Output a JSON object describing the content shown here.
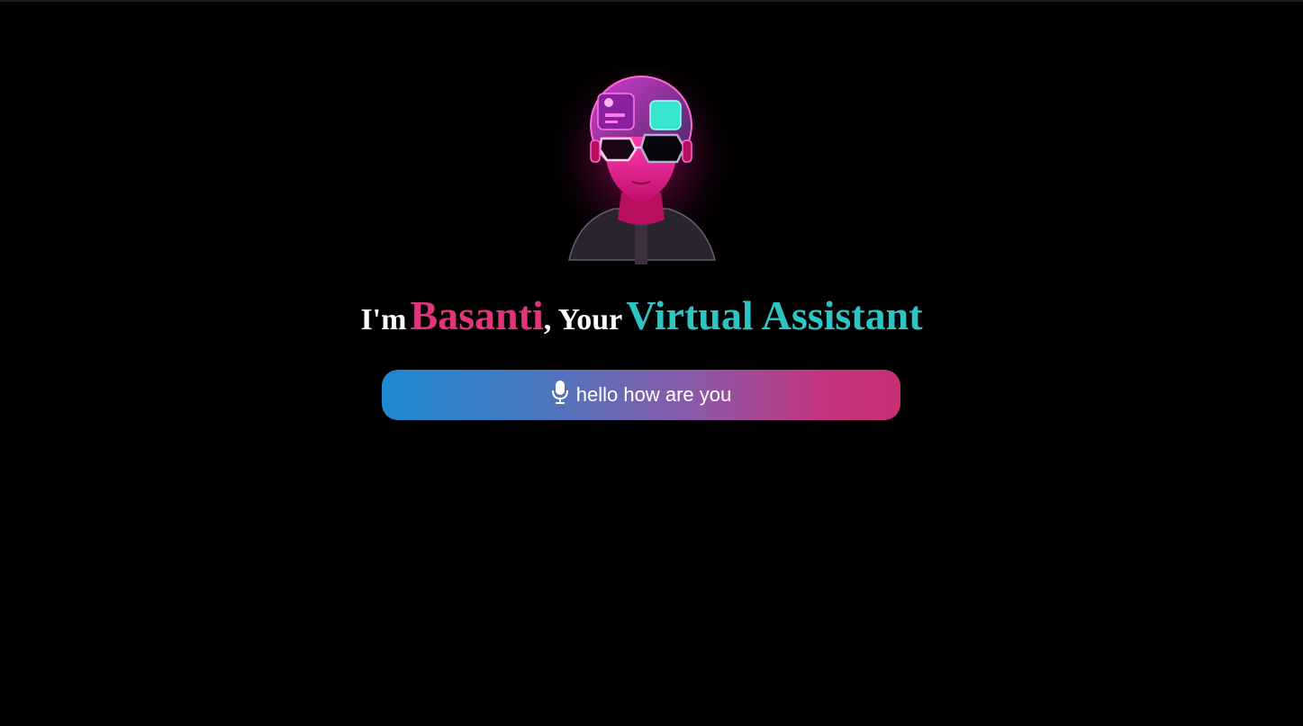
{
  "assistant": {
    "greeting_prefix": "I'm",
    "name": "Basanti",
    "greeting_mid": ", Your",
    "role": "Virtual Assistant"
  },
  "voice": {
    "transcript": "hello how are you",
    "icon": "microphone-icon"
  },
  "avatar": {
    "icon": "cyberpunk-robot-avatar"
  },
  "colors": {
    "background": "#000000",
    "name_accent": "#e0357a",
    "role_accent": "#2ec4c4",
    "gradient_start": "#1d8ad0",
    "gradient_end": "#c82e72"
  }
}
